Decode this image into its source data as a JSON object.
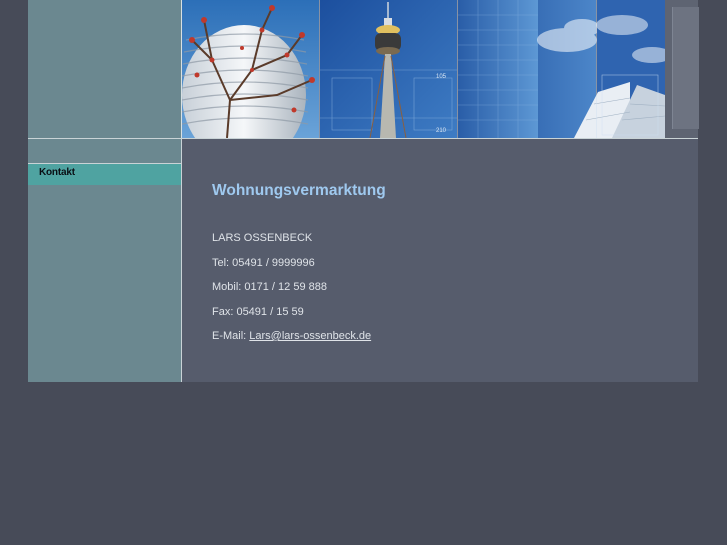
{
  "sidebar": {
    "items": [
      {
        "label": "Kontakt"
      }
    ]
  },
  "header": {
    "image_labels": [
      "105",
      "210"
    ]
  },
  "main": {
    "title": "Wohnungsvermarktung",
    "name": "LARS OSSENBECK",
    "phone": "Tel: 05491 / 9999996",
    "mobile": "Mobil: 0171 / 12 59 888",
    "fax": "Fax: 05491 / 15 59",
    "email_prefix": "E-Mail: ",
    "email": "Lars@lars-ossenbeck.de"
  },
  "colors": {
    "background": "#474b58",
    "panel": "#565c6c",
    "sidebar": "#6b8890",
    "nav_active": "#4fa3a1",
    "title": "#9fc9ef",
    "text": "#dfe3e8"
  }
}
